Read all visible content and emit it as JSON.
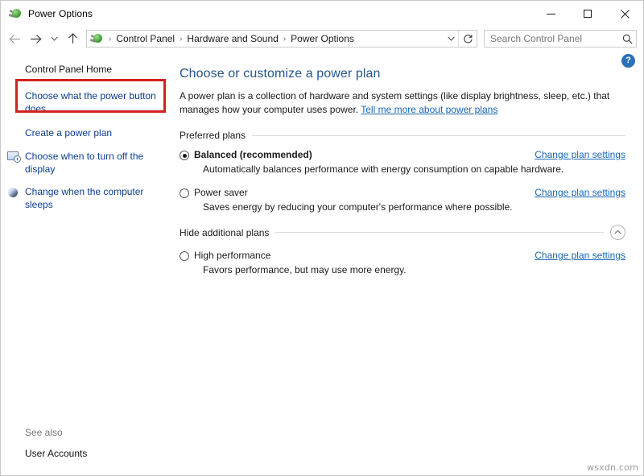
{
  "window": {
    "title": "Power Options",
    "title_icon": "power-plug-icon",
    "controls": {
      "minimize": "─",
      "maximize": "□",
      "close": "✕"
    }
  },
  "navbar": {
    "back_icon": "arrow-left-icon",
    "forward_icon": "arrow-right-icon",
    "recent_icon": "chevron-down-icon",
    "up_icon": "arrow-up-icon",
    "address_icon": "power-plug-icon",
    "breadcrumbs": [
      "Control Panel",
      "Hardware and Sound",
      "Power Options"
    ],
    "separator": "›",
    "dropdown_icon": "chevron-down-icon",
    "refresh_icon": "refresh-icon",
    "search": {
      "placeholder": "Search Control Panel",
      "value": "",
      "icon": "search-icon"
    }
  },
  "sidebar": {
    "items": [
      {
        "label": "Control Panel Home",
        "icon": null,
        "highlighted": false
      },
      {
        "label": "Choose what the power button does",
        "icon": null,
        "highlighted": true
      },
      {
        "label": "Create a power plan",
        "icon": null,
        "highlighted": false
      },
      {
        "label": "Choose when to turn off the display",
        "icon": "display-icon",
        "highlighted": false
      },
      {
        "label": "Change when the computer sleeps",
        "icon": "sleep-icon",
        "highlighted": false
      }
    ],
    "see_also": {
      "title": "See also",
      "links": [
        "User Accounts"
      ]
    }
  },
  "main": {
    "help_icon": "help-icon",
    "help_label": "?",
    "title": "Choose or customize a power plan",
    "intro_text": "A power plan is a collection of hardware and system settings (like display brightness, sleep, etc.) that manages how your computer uses power. ",
    "intro_link": "Tell me more about power plans",
    "preferred_section": {
      "label": "Preferred plans",
      "plans": [
        {
          "name": "Balanced (recommended)",
          "description": "Automatically balances performance with energy consumption on capable hardware.",
          "selected": true,
          "action_label": "Change plan settings"
        },
        {
          "name": "Power saver",
          "description": "Saves energy by reducing your computer's performance where possible.",
          "selected": false,
          "action_label": "Change plan settings"
        }
      ]
    },
    "additional_section": {
      "label": "Hide additional plans",
      "collapse_icon": "chevron-up-icon",
      "plans": [
        {
          "name": "High performance",
          "description": "Favors performance, but may use more energy.",
          "selected": false,
          "action_label": "Change plan settings"
        }
      ]
    }
  },
  "watermark": "wsxdn.com",
  "colors": {
    "accent_link": "#1866b5",
    "title_blue": "#25558c",
    "highlight_red": "#d32022",
    "help_blue": "#2a71b8"
  }
}
